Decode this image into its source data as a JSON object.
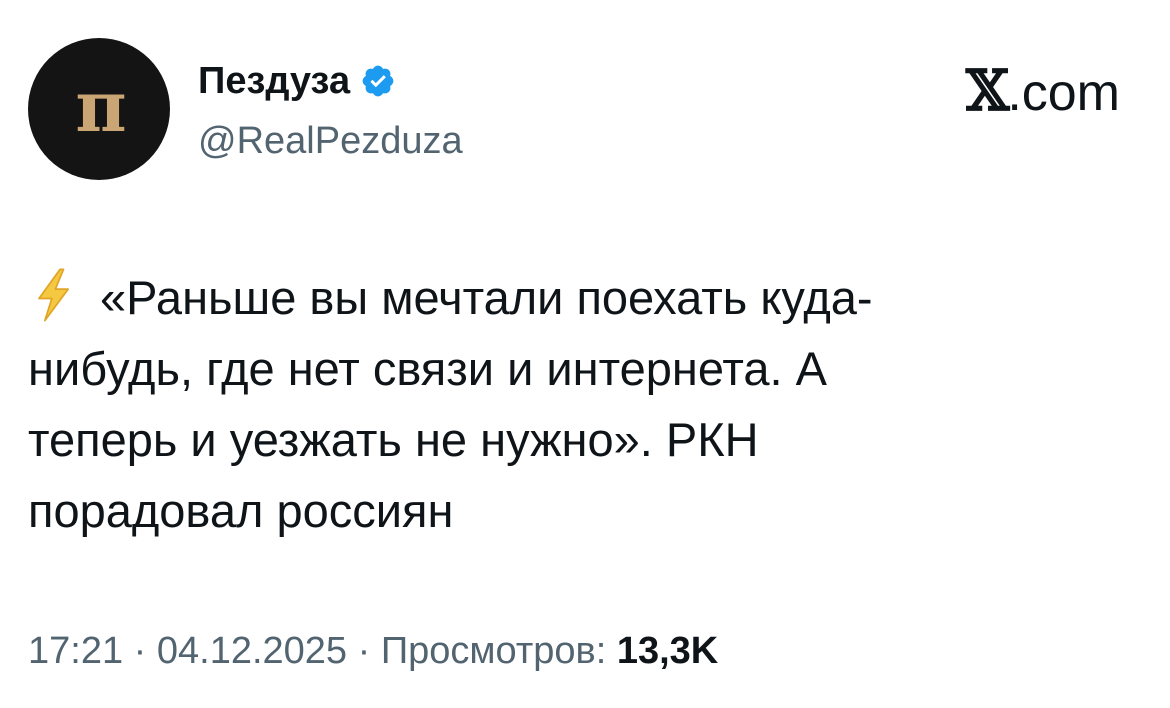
{
  "author": {
    "display_name": "Пездуза",
    "handle": "@RealPezduza",
    "avatar_text": "п"
  },
  "brand": {
    "x": "𝕏",
    "domain": ".com"
  },
  "tweet": {
    "icon": "lightning-bolt-icon",
    "line1": "«Раньше вы мечтали поехать куда-",
    "line2": "нибудь, где нет связи и интернета. А",
    "line3": "теперь и уезжать не нужно». РКН",
    "line4": "порадовал россиян"
  },
  "meta": {
    "time": "17:21",
    "separator": " · ",
    "date": "04.12.2025",
    "views_label": "Просмотров:",
    "views_count": "13,3K"
  },
  "colors": {
    "verified": "#1d9bf0",
    "secondary_text": "#536471",
    "primary_text": "#0f1419",
    "avatar_bg": "#141414",
    "avatar_logo": "#c9a673",
    "bolt": "#f5c842"
  }
}
